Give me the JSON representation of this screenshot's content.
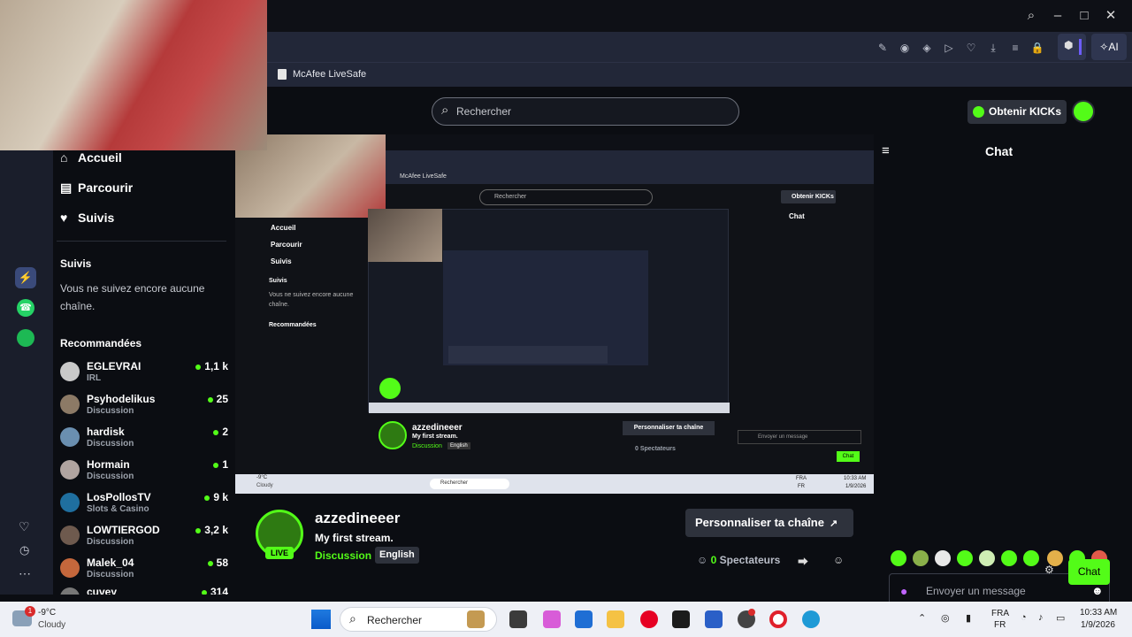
{
  "browser": {
    "bookmark": "McAfee LiveSafe",
    "ai_label": "AI"
  },
  "opera_sidebar": {
    "icons": [
      "messenger-icon",
      "whatsapp-icon",
      "spotify-icon",
      "heart-icon",
      "clock-icon",
      "more-icon"
    ]
  },
  "topnav": {
    "search_placeholder": "Rechercher",
    "kicks_label": "Obtenir KICKs"
  },
  "sidebar": {
    "nav": [
      {
        "label": "Accueil",
        "icon": "home-icon"
      },
      {
        "label": "Parcourir",
        "icon": "browse-icon"
      },
      {
        "label": "Suivis",
        "icon": "heart-icon"
      }
    ],
    "followed_title": "Suivis",
    "followed_empty": "Vous ne suivez encore aucune chaîne.",
    "recommended_title": "Recommandées",
    "recommended": [
      {
        "name": "EGLEVRAI",
        "category": "IRL",
        "viewers": "1,1 k",
        "color": "#c9c9c9"
      },
      {
        "name": "Psyhodelikus",
        "category": "Discussion",
        "viewers": "25",
        "color": "#8c7a66"
      },
      {
        "name": "hardisk",
        "category": "Discussion",
        "viewers": "2",
        "color": "#6a8fb0"
      },
      {
        "name": "Hormain",
        "category": "Discussion",
        "viewers": "1",
        "color": "#b0a4a0"
      },
      {
        "name": "LosPollosTV",
        "category": "Slots & Casino",
        "viewers": "9 k",
        "color": "#1f6f9f"
      },
      {
        "name": "LOWTIERGOD",
        "category": "Discussion",
        "viewers": "3,2 k",
        "color": "#6e5a4e"
      },
      {
        "name": "Malek_04",
        "category": "Discussion",
        "viewers": "58",
        "color": "#c4673c"
      },
      {
        "name": "cuvey",
        "category": "",
        "viewers": "314",
        "color": "#777777"
      }
    ]
  },
  "stream": {
    "live_badge": "LIVE",
    "channel": "azzedineeer",
    "title": "My first stream.",
    "category": "Discussion",
    "language": "English",
    "customize_label": "Personnaliser ta chaîne",
    "viewers_count": "0",
    "viewers_label": "Spectateurs"
  },
  "chat": {
    "title": "Chat",
    "input_placeholder": "Envoyer un message",
    "send_label": "Chat"
  },
  "nested_screen": {
    "bookmark": "McAfee LiveSafe",
    "search": "Rechercher",
    "kicks": "Obtenir KICKs",
    "chat_title": "Chat",
    "nav": [
      "Accueil",
      "Parcourir",
      "Suivis"
    ],
    "followed_title": "Suivis",
    "followed_empty": "Vous ne suivez encore aucune chaîne.",
    "recommended_title": "Recommandées",
    "channel": "azzedineeer",
    "title": "My first stream.",
    "category": "Discussion",
    "language": "English",
    "customize": "Personnaliser ta chaîne",
    "viewers": "0 Spectateurs",
    "input": "Envoyer un message",
    "send": "Chat",
    "weather_temp": "-9°C",
    "weather_desc": "Cloudy",
    "taskbar_search": "Rechercher",
    "lang1": "FRA",
    "lang2": "FR",
    "time": "10:33 AM",
    "date": "1/9/2026"
  },
  "taskbar": {
    "weather_badge": "1",
    "weather_temp": "-9°C",
    "weather_desc": "Cloudy",
    "search_label": "Rechercher",
    "lang1": "FRA",
    "lang2": "FR",
    "time": "10:33 AM",
    "date": "1/9/2026"
  },
  "colors": {
    "accent": "#53fc18",
    "chrome": "#222738",
    "page_bg": "#0b0d12"
  }
}
